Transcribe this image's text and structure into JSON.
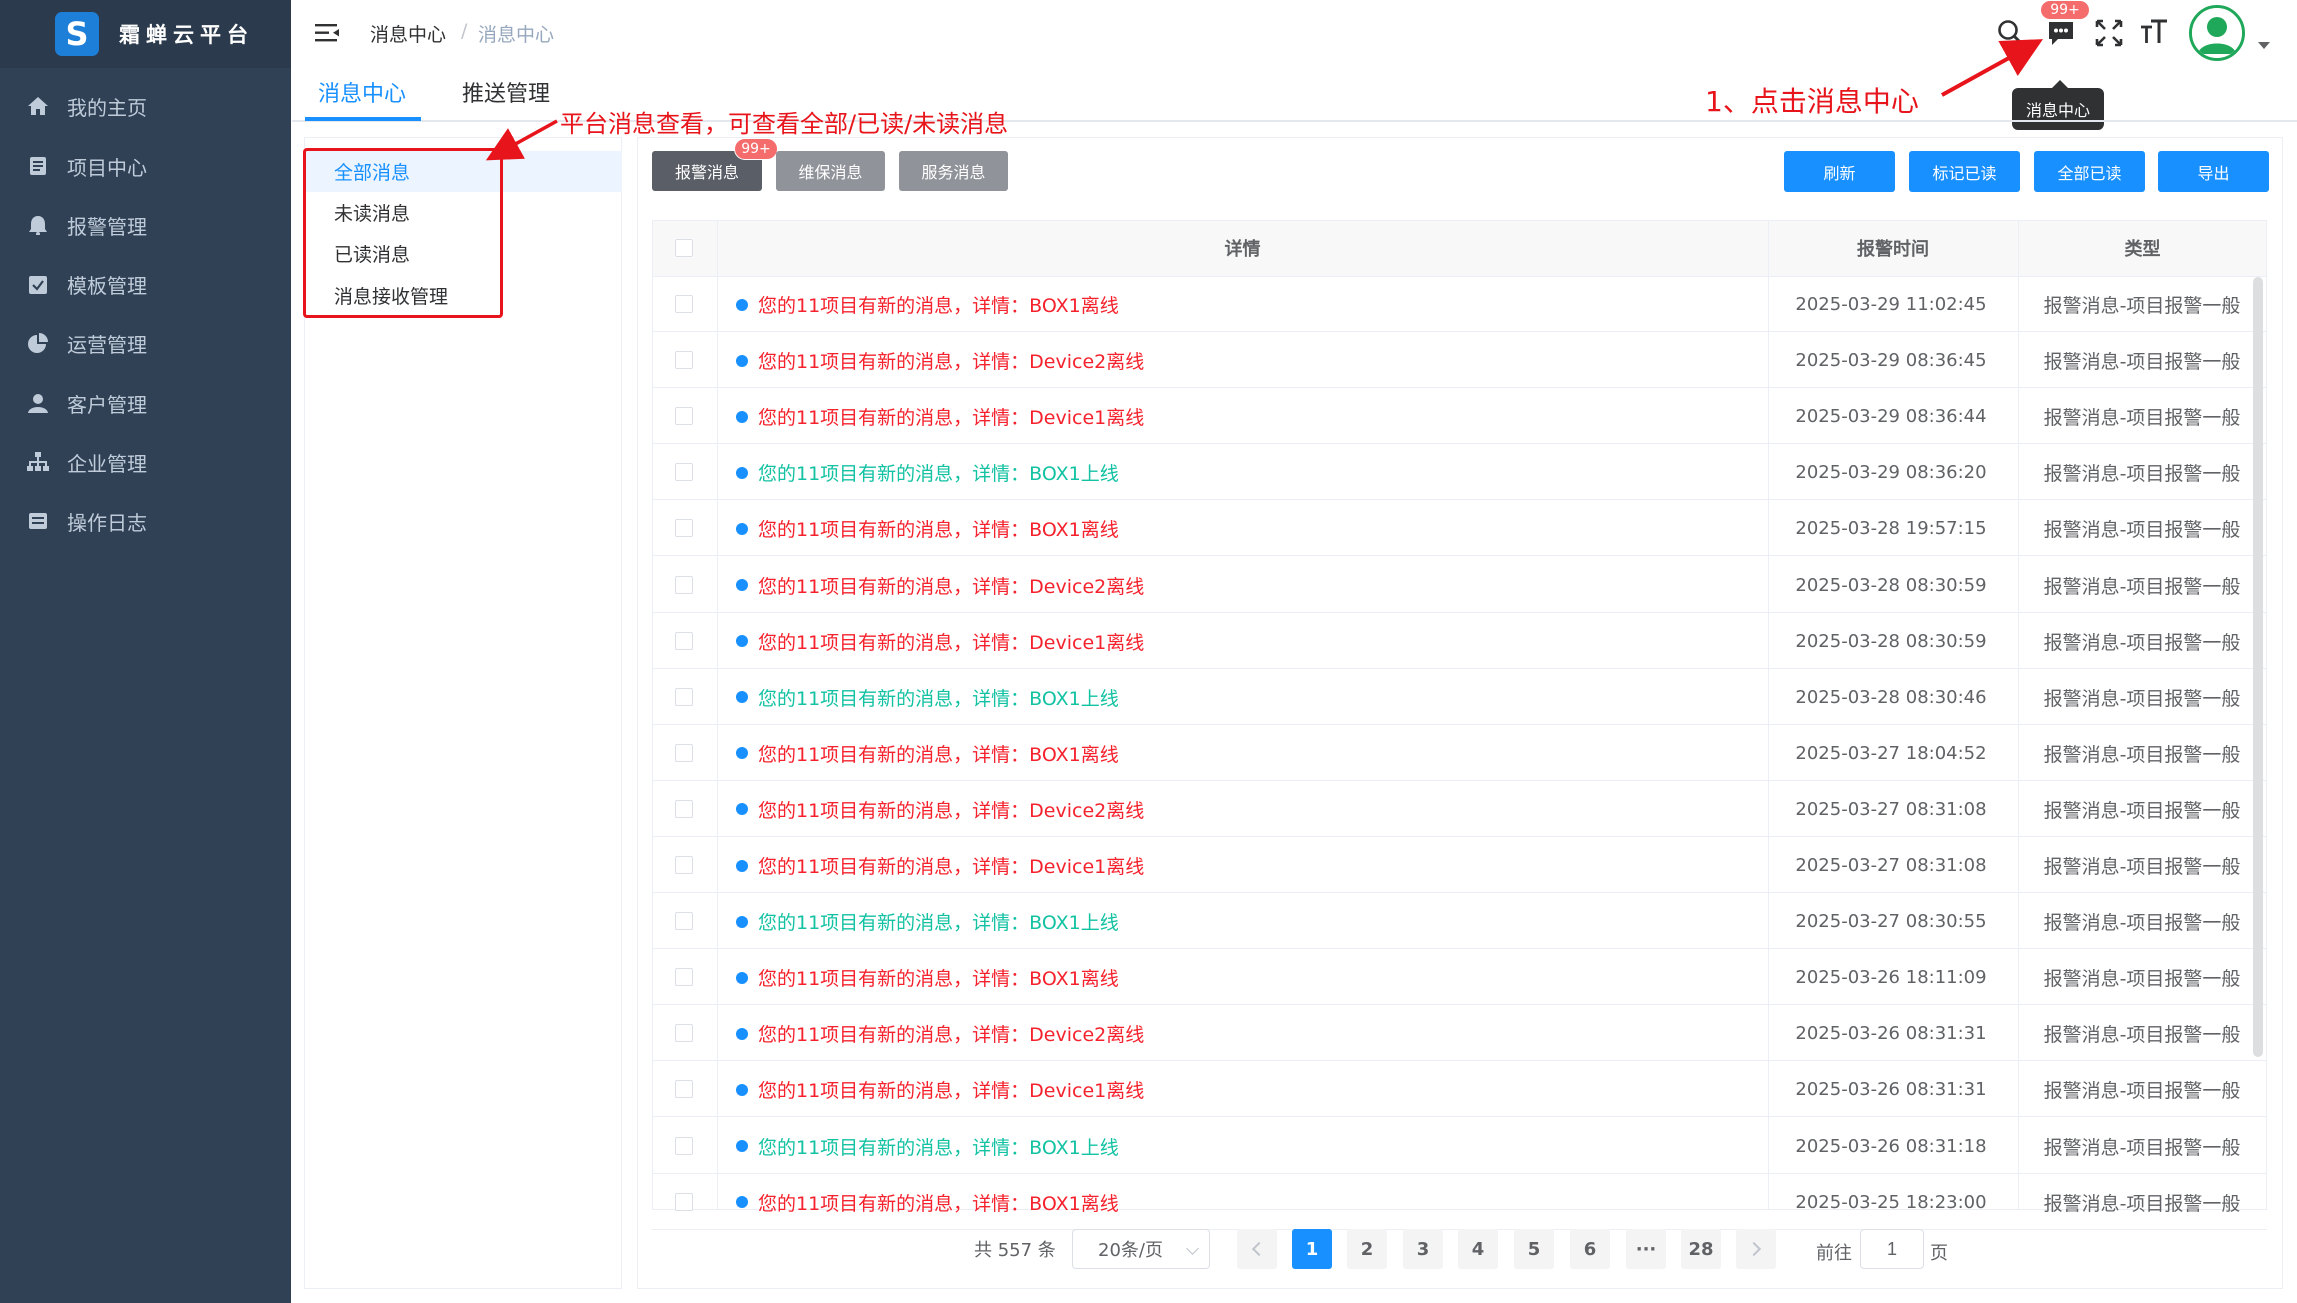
{
  "brand": {
    "logo_letter": "S",
    "name": "霜蝉云平台"
  },
  "sidebar": {
    "items": [
      {
        "label": "我的主页",
        "icon": "home-icon"
      },
      {
        "label": "项目中心",
        "icon": "folder-icon"
      },
      {
        "label": "报警管理",
        "icon": "bell-icon"
      },
      {
        "label": "模板管理",
        "icon": "clipboard-icon"
      },
      {
        "label": "运营管理",
        "icon": "pie-chart-icon"
      },
      {
        "label": "客户管理",
        "icon": "user-icon"
      },
      {
        "label": "企业管理",
        "icon": "org-tree-icon"
      },
      {
        "label": "操作日志",
        "icon": "log-icon"
      }
    ]
  },
  "header": {
    "breadcrumb": [
      "消息中心",
      "消息中心"
    ],
    "breadcrumb_sep": "/",
    "message_badge": "99+",
    "tooltip": "消息中心"
  },
  "tabs": [
    "消息中心",
    "推送管理"
  ],
  "message_menu": [
    "全部消息",
    "未读消息",
    "已读消息",
    "消息接收管理"
  ],
  "type_buttons": {
    "alarm": "报警消息",
    "maintenance": "维保消息",
    "service": "服务消息",
    "alarm_badge": "99+"
  },
  "action_buttons": {
    "refresh": "刷新",
    "mark_read": "标记已读",
    "all_read": "全部已读",
    "export": "导出"
  },
  "table": {
    "columns": {
      "detail": "详情",
      "time": "报警时间",
      "type": "类型"
    },
    "rows": [
      {
        "detail": "您的11项目有新的消息，详情：BOX1离线",
        "time": "2025-03-29 11:02:45",
        "type": "报警消息-项目报警一般",
        "status": "offline"
      },
      {
        "detail": "您的11项目有新的消息，详情：Device2离线",
        "time": "2025-03-29 08:36:45",
        "type": "报警消息-项目报警一般",
        "status": "offline"
      },
      {
        "detail": "您的11项目有新的消息，详情：Device1离线",
        "time": "2025-03-29 08:36:44",
        "type": "报警消息-项目报警一般",
        "status": "offline"
      },
      {
        "detail": "您的11项目有新的消息，详情：BOX1上线",
        "time": "2025-03-29 08:36:20",
        "type": "报警消息-项目报警一般",
        "status": "online"
      },
      {
        "detail": "您的11项目有新的消息，详情：BOX1离线",
        "time": "2025-03-28 19:57:15",
        "type": "报警消息-项目报警一般",
        "status": "offline"
      },
      {
        "detail": "您的11项目有新的消息，详情：Device2离线",
        "time": "2025-03-28 08:30:59",
        "type": "报警消息-项目报警一般",
        "status": "offline"
      },
      {
        "detail": "您的11项目有新的消息，详情：Device1离线",
        "time": "2025-03-28 08:30:59",
        "type": "报警消息-项目报警一般",
        "status": "offline"
      },
      {
        "detail": "您的11项目有新的消息，详情：BOX1上线",
        "time": "2025-03-28 08:30:46",
        "type": "报警消息-项目报警一般",
        "status": "online"
      },
      {
        "detail": "您的11项目有新的消息，详情：BOX1离线",
        "time": "2025-03-27 18:04:52",
        "type": "报警消息-项目报警一般",
        "status": "offline"
      },
      {
        "detail": "您的11项目有新的消息，详情：Device2离线",
        "time": "2025-03-27 08:31:08",
        "type": "报警消息-项目报警一般",
        "status": "offline"
      },
      {
        "detail": "您的11项目有新的消息，详情：Device1离线",
        "time": "2025-03-27 08:31:08",
        "type": "报警消息-项目报警一般",
        "status": "offline"
      },
      {
        "detail": "您的11项目有新的消息，详情：BOX1上线",
        "time": "2025-03-27 08:30:55",
        "type": "报警消息-项目报警一般",
        "status": "online"
      },
      {
        "detail": "您的11项目有新的消息，详情：BOX1离线",
        "time": "2025-03-26 18:11:09",
        "type": "报警消息-项目报警一般",
        "status": "offline"
      },
      {
        "detail": "您的11项目有新的消息，详情：Device2离线",
        "time": "2025-03-26 08:31:31",
        "type": "报警消息-项目报警一般",
        "status": "offline"
      },
      {
        "detail": "您的11项目有新的消息，详情：Device1离线",
        "time": "2025-03-26 08:31:31",
        "type": "报警消息-项目报警一般",
        "status": "offline"
      },
      {
        "detail": "您的11项目有新的消息，详情：BOX1上线",
        "time": "2025-03-26 08:31:18",
        "type": "报警消息-项目报警一般",
        "status": "online"
      },
      {
        "detail": "您的11项目有新的消息，详情：BOX1离线",
        "time": "2025-03-25 18:23:00",
        "type": "报警消息-项目报警一般",
        "status": "offline"
      }
    ]
  },
  "pagination": {
    "total": "共 557 条",
    "page_size": "20条/页",
    "pages": [
      "1",
      "2",
      "3",
      "4",
      "5",
      "6",
      "···",
      "28"
    ],
    "current": "1",
    "goto_label": "前往",
    "goto_value": "1",
    "page_suffix": "页"
  },
  "annotations": {
    "left": "平台消息查看，可查看全部/已读/未读消息",
    "right": "1、点击消息中心"
  },
  "colors": {
    "offline": "#f5222d",
    "online": "#13c2a3",
    "primary": "#1890ff",
    "annotation": "#e8141b",
    "sidebar": "#304156"
  }
}
